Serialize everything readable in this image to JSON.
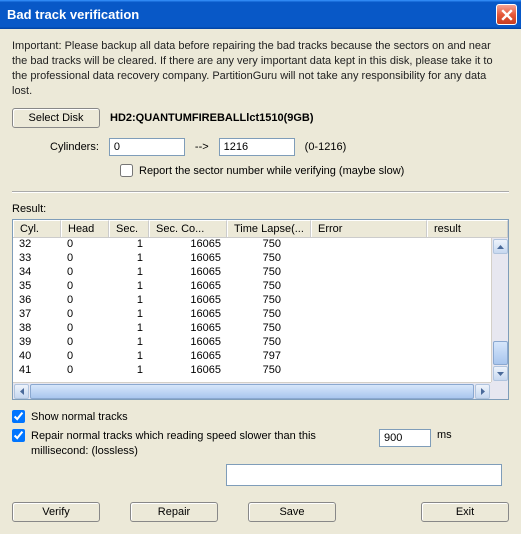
{
  "title": "Bad track verification",
  "note": "Important: Please backup all data before repairing the bad tracks because the sectors on and near the bad tracks will be cleared. If there are any very important data kept in this disk, please take it to the professional data recovery company. PartitionGuru will not take any responsibility for any data lost.",
  "selectDisk": "Select Disk",
  "diskName": "HD2:QUANTUMFIREBALLlct1510(9GB)",
  "cylindersLabel": "Cylinders:",
  "cylFrom": "0",
  "arrow": "-->",
  "cylTo": "1216",
  "cylRange": "(0-1216)",
  "reportSector": "Report the sector number while verifying (maybe slow)",
  "resultLabel": "Result:",
  "headers": {
    "cyl": "Cyl.",
    "head": "Head",
    "sec": "Sec.",
    "secCo": "Sec. Co...",
    "timeLapse": "Time Lapse(...",
    "error": "Error",
    "result": "result"
  },
  "rows": [
    {
      "cyl": "32",
      "head": "0",
      "sec": "1",
      "secCo": "16065",
      "time": "750",
      "error": "",
      "result": ""
    },
    {
      "cyl": "33",
      "head": "0",
      "sec": "1",
      "secCo": "16065",
      "time": "750",
      "error": "",
      "result": ""
    },
    {
      "cyl": "34",
      "head": "0",
      "sec": "1",
      "secCo": "16065",
      "time": "750",
      "error": "",
      "result": ""
    },
    {
      "cyl": "35",
      "head": "0",
      "sec": "1",
      "secCo": "16065",
      "time": "750",
      "error": "",
      "result": ""
    },
    {
      "cyl": "36",
      "head": "0",
      "sec": "1",
      "secCo": "16065",
      "time": "750",
      "error": "",
      "result": ""
    },
    {
      "cyl": "37",
      "head": "0",
      "sec": "1",
      "secCo": "16065",
      "time": "750",
      "error": "",
      "result": ""
    },
    {
      "cyl": "38",
      "head": "0",
      "sec": "1",
      "secCo": "16065",
      "time": "750",
      "error": "",
      "result": ""
    },
    {
      "cyl": "39",
      "head": "0",
      "sec": "1",
      "secCo": "16065",
      "time": "750",
      "error": "",
      "result": ""
    },
    {
      "cyl": "40",
      "head": "0",
      "sec": "1",
      "secCo": "16065",
      "time": "797",
      "error": "",
      "result": ""
    },
    {
      "cyl": "41",
      "head": "0",
      "sec": "1",
      "secCo": "16065",
      "time": "750",
      "error": "",
      "result": ""
    }
  ],
  "showNormal": "Show normal tracks",
  "repairNormal": "Repair normal tracks which reading speed slower than this millisecond: (lossless)",
  "msValue": "900",
  "msUnit": "ms",
  "longValue": "",
  "buttons": {
    "verify": "Verify",
    "repair": "Repair",
    "save": "Save",
    "exit": "Exit"
  }
}
